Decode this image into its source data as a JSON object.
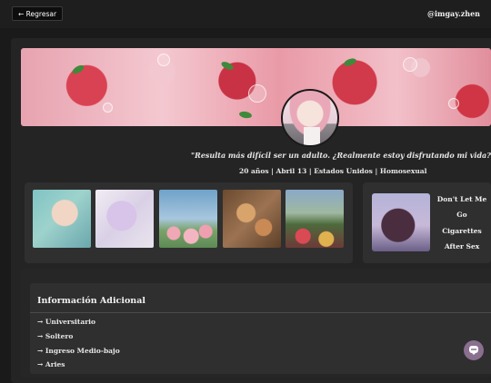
{
  "header": {
    "back_label": "← Regresar",
    "username": "@imgay.zhen"
  },
  "profile": {
    "quote": "\"Resulta más difícil ser un adulto. ¿Realmente estoy disfrutando mi vida?\"",
    "meta": "20 años | Abril 13 | Estados Unidos | Homosexual"
  },
  "gallery": {
    "images": [
      {
        "icon": "anime-boy-blue-hair-image"
      },
      {
        "icon": "anime-boy-lying-flowers-image"
      },
      {
        "icon": "tulips-sky-image"
      },
      {
        "icon": "picnic-food-image"
      },
      {
        "icon": "flower-field-tree-image"
      }
    ]
  },
  "music": {
    "cover_icon": "album-cover-couple-image",
    "songs": [
      "Don't Let Me Go",
      "Cigarettes After Sex"
    ]
  },
  "info": {
    "title": "Información Adicional",
    "items": [
      "→ Universitario",
      "→ Soltero",
      "→ Ingreso Medio-bajo",
      "→ Aries"
    ]
  },
  "colors": {
    "background": "#1a1a1a",
    "panel": "#242424",
    "card": "#2f2f2f",
    "accent": "#8a6f8f",
    "text": "#e6e6e6"
  }
}
